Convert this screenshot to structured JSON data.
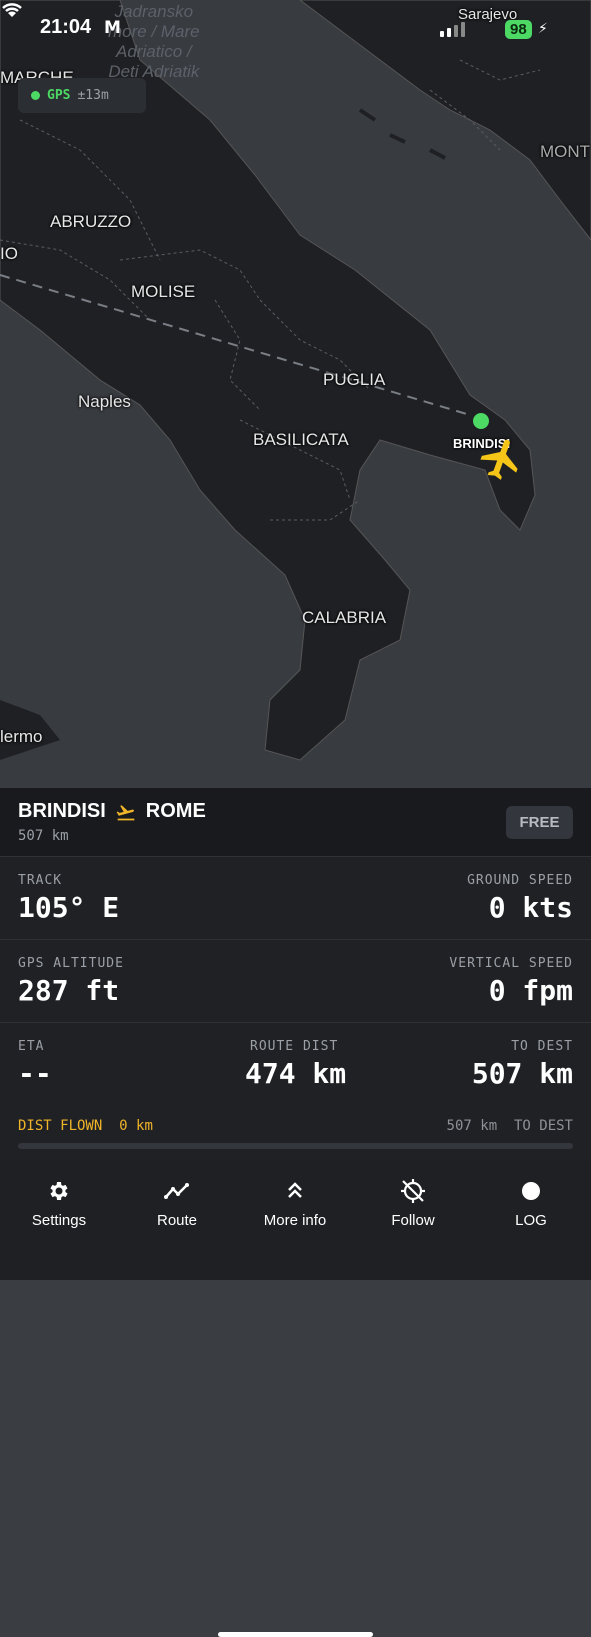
{
  "status_bar": {
    "time": "21:04",
    "mail_glyph": "M",
    "battery": "98",
    "bolt": "⚡"
  },
  "gps": {
    "label": "GPS",
    "accuracy": "±13m",
    "color": "#4cd964"
  },
  "map": {
    "labels": {
      "sarajevo": "Sarajevo",
      "sea_line1": "Jadransko",
      "sea_line2": "more / Mare",
      "sea_line3": "Adriatico /",
      "sea_line4": "Deti Adriatik",
      "marche": "MARCHE",
      "abruzzo": "ABRUZZO",
      "molise": "MOLISE",
      "naples": "Naples",
      "puglia": "PUGLIA",
      "brindisi": "BRINDISI",
      "basilicata": "BASILICATA",
      "calabria": "CALABRIA",
      "palermo": "lermo",
      "montenegro": "MONT",
      "lazio_partial": "IO"
    }
  },
  "route": {
    "origin": "BRINDISI",
    "destination": "ROME",
    "distance": "507 km",
    "free_button": "FREE",
    "accent": "#f0b429"
  },
  "stats": {
    "track_label": "TRACK",
    "track_value": "105° E",
    "ground_speed_label": "GROUND SPEED",
    "ground_speed_value": "0 kts",
    "gps_altitude_label": "GPS ALTITUDE",
    "gps_altitude_value": "287 ft",
    "vertical_speed_label": "VERTICAL SPEED",
    "vertical_speed_value": "0 fpm",
    "eta_label": "ETA",
    "eta_value": "--",
    "route_dist_label": "ROUTE DIST",
    "route_dist_value": "474 km",
    "to_dest_label": "TO DEST",
    "to_dest_value": "507 km"
  },
  "progress": {
    "dist_flown_label": "DIST FLOWN",
    "dist_flown_value": "0 km",
    "remaining_value": "507 km",
    "remaining_label": "TO DEST",
    "fraction": 0.0
  },
  "tabs": [
    {
      "label": "Settings",
      "icon": "gear-icon"
    },
    {
      "label": "Route",
      "icon": "route-icon"
    },
    {
      "label": "More info",
      "icon": "chevrons-up-icon"
    },
    {
      "label": "Follow",
      "icon": "crosshair-off-icon"
    },
    {
      "label": "LOG",
      "icon": "record-dot-icon"
    }
  ]
}
